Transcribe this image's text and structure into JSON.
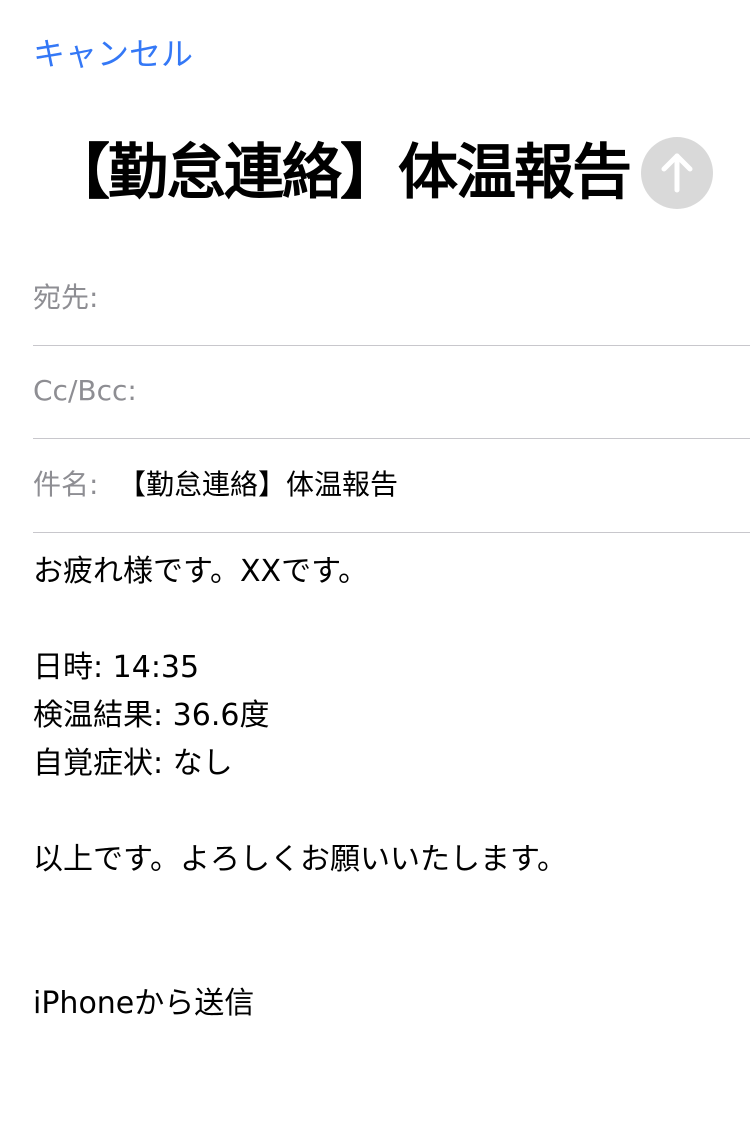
{
  "header": {
    "cancel_label": "キャンセル",
    "title": "【勤怠連絡】体温報告",
    "send_icon": "arrow-up-icon"
  },
  "fields": {
    "to_label": "宛先:",
    "to_value": "",
    "cc_label": "Cc/Bcc:",
    "cc_value": "",
    "subject_label": "件名:",
    "subject_value": "【勤怠連絡】体温報告"
  },
  "body": {
    "greeting": "お疲れ様です。XXです。",
    "datetime": "日時: 14:35",
    "temperature": "検温結果: 36.6度",
    "symptoms": "自覚症状: なし",
    "closing": "以上です。よろしくお願いいたします。",
    "signature": "iPhoneから送信"
  },
  "colors": {
    "accent": "#3478f6",
    "label_gray": "#8e8e93",
    "separator": "#c8c7cc",
    "send_button_disabled": "#d9d9d9"
  }
}
